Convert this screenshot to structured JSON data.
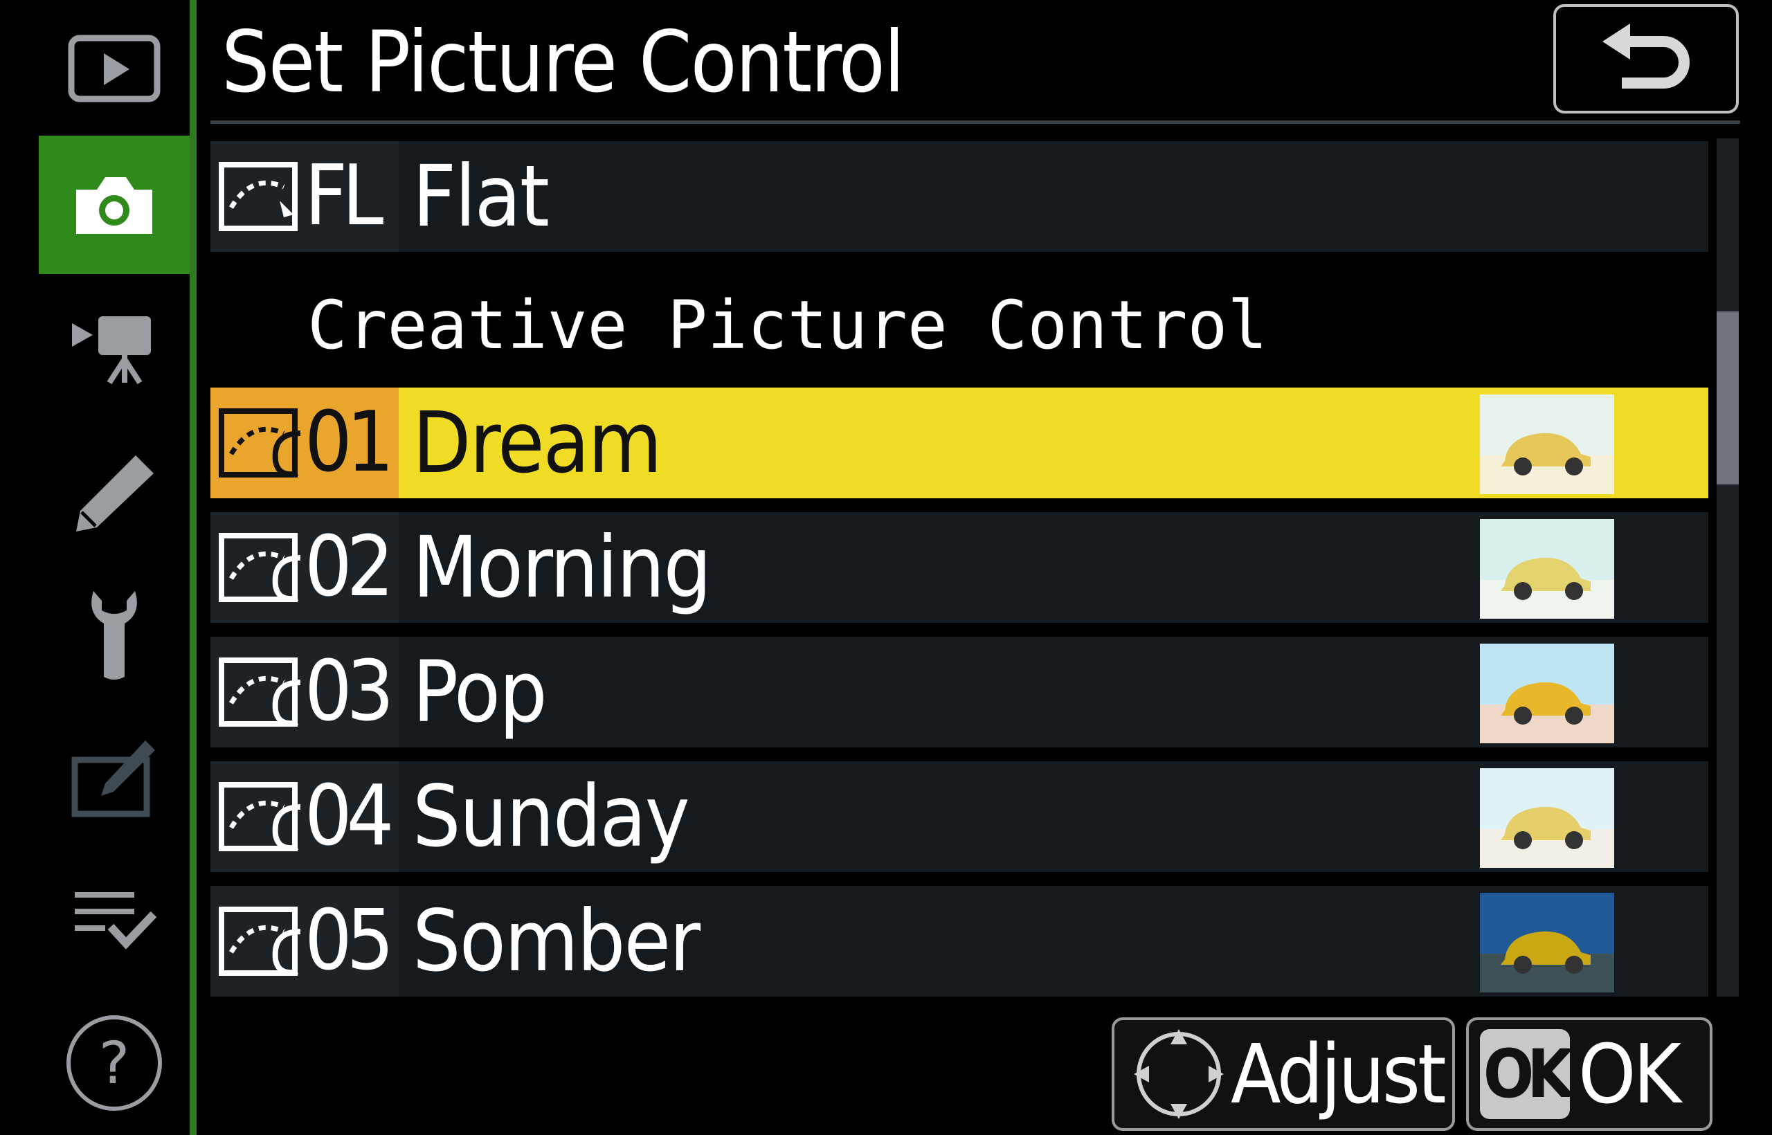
{
  "header": {
    "title": "Set Picture Control"
  },
  "sidebar": {
    "items": [
      {
        "name": "playback-menu-tab",
        "icon": "playback-icon"
      },
      {
        "name": "photo-shooting-menu-tab",
        "icon": "camera-icon",
        "active": true
      },
      {
        "name": "movie-shooting-menu-tab",
        "icon": "movie-camera-icon"
      },
      {
        "name": "custom-settings-menu-tab",
        "icon": "pencil-icon"
      },
      {
        "name": "setup-menu-tab",
        "icon": "wrench-icon"
      },
      {
        "name": "retouch-menu-tab",
        "icon": "retouch-icon"
      },
      {
        "name": "my-menu-tab",
        "icon": "my-menu-icon"
      },
      {
        "name": "help-tab",
        "icon": "help-icon",
        "label": "?"
      }
    ]
  },
  "list": {
    "top_item": {
      "code": "FL",
      "name": "Flat"
    },
    "section_label": "Creative Picture Control",
    "items": [
      {
        "code": "01",
        "name": "Dream",
        "selected": true
      },
      {
        "code": "02",
        "name": "Morning"
      },
      {
        "code": "03",
        "name": "Pop"
      },
      {
        "code": "04",
        "name": "Sunday"
      },
      {
        "code": "05",
        "name": "Somber"
      }
    ]
  },
  "footer": {
    "adjust_label": "Adjust",
    "ok_key": "OK",
    "ok_label": "OK"
  },
  "colors": {
    "accent_green": "#2f8a1b",
    "selected_row": "#f0dc24",
    "selected_badge": "#eaa52c"
  }
}
